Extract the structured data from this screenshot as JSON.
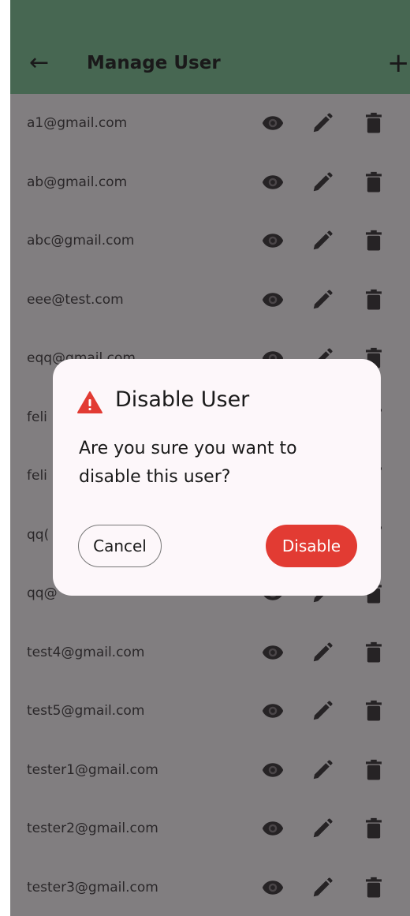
{
  "app_bar": {
    "title": "Manage User",
    "back_icon": "arrow-left-icon",
    "add_icon": "plus-icon"
  },
  "users": [
    "a1@gmail.com",
    "ab@gmail.com",
    "abc@gmail.com",
    "eee@test.com",
    "eqq@gmail.com",
    "feli",
    "feli",
    "qq(",
    "qq@",
    "test4@gmail.com",
    "test5@gmail.com",
    "tester1@gmail.com",
    "tester2@gmail.com",
    "tester3@gmail.com"
  ],
  "row_actions": {
    "view_icon": "eye-icon",
    "edit_icon": "pencil-icon",
    "delete_icon": "trash-icon"
  },
  "dialog": {
    "icon": "warning-icon",
    "title": "Disable User",
    "message": "Are you sure you want to disable this user?",
    "cancel_label": "Cancel",
    "confirm_label": "Disable"
  },
  "colors": {
    "app_bar": "#4f7d5f",
    "danger": "#e23b33",
    "dialog_bg": "#fdf7fa"
  }
}
